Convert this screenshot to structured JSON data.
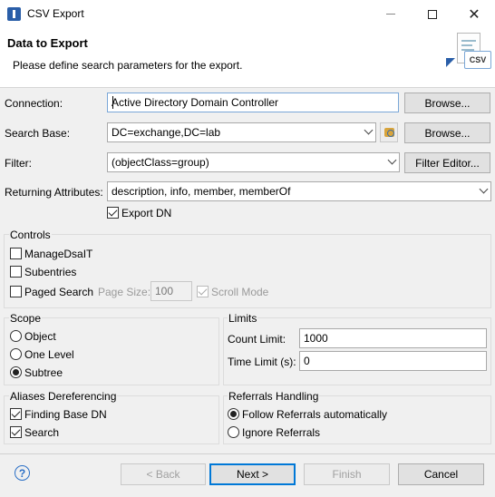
{
  "window": {
    "title": "CSV Export",
    "close_glyph": "✕"
  },
  "header": {
    "title": "Data to Export",
    "description": "Please define search parameters for the export.",
    "graphic_badge": "CSV"
  },
  "connection": {
    "label": "Connection:",
    "value": "Active Directory Domain Controller",
    "browse_label": "Browse..."
  },
  "search_base": {
    "label": "Search Base:",
    "value": "DC=exchange,DC=lab",
    "browse_label": "Browse..."
  },
  "filter": {
    "label": "Filter:",
    "value": "(objectClass=group)",
    "editor_label": "Filter Editor..."
  },
  "returning_attributes": {
    "label": "Returning Attributes:",
    "value": "description, info, member, memberOf"
  },
  "export_dn": {
    "label": "Export DN",
    "checked": true
  },
  "controls": {
    "title": "Controls",
    "manage_dsa_it": {
      "label": "ManageDsaIT",
      "checked": false
    },
    "subentries": {
      "label": "Subentries",
      "checked": false
    },
    "paged_search": {
      "label": "Paged Search",
      "checked": false
    },
    "page_size_label": "Page Size:",
    "page_size_value": "100",
    "scroll_mode": {
      "label": "Scroll Mode",
      "checked": true,
      "enabled": false
    }
  },
  "scope": {
    "title": "Scope",
    "options": [
      {
        "label": "Object",
        "selected": false
      },
      {
        "label": "One Level",
        "selected": false
      },
      {
        "label": "Subtree",
        "selected": true
      }
    ]
  },
  "limits": {
    "title": "Limits",
    "count_limit_label": "Count Limit:",
    "count_limit_value": "1000",
    "time_limit_label": "Time Limit (s):",
    "time_limit_value": "0"
  },
  "aliases": {
    "title": "Aliases Dereferencing",
    "finding_base_dn": {
      "label": "Finding Base DN",
      "checked": true
    },
    "search": {
      "label": "Search",
      "checked": true
    }
  },
  "referrals": {
    "title": "Referrals Handling",
    "options": [
      {
        "label": "Follow Referrals automatically",
        "selected": true
      },
      {
        "label": "Ignore Referrals",
        "selected": false
      }
    ]
  },
  "footer": {
    "help_glyph": "?",
    "back_label": "< Back",
    "next_label": "Next >",
    "finish_label": "Finish",
    "cancel_label": "Cancel"
  },
  "colors": {
    "accent": "#0078d7",
    "dialog_bg": "#f0f0f0",
    "header_bg": "#ffffff"
  }
}
